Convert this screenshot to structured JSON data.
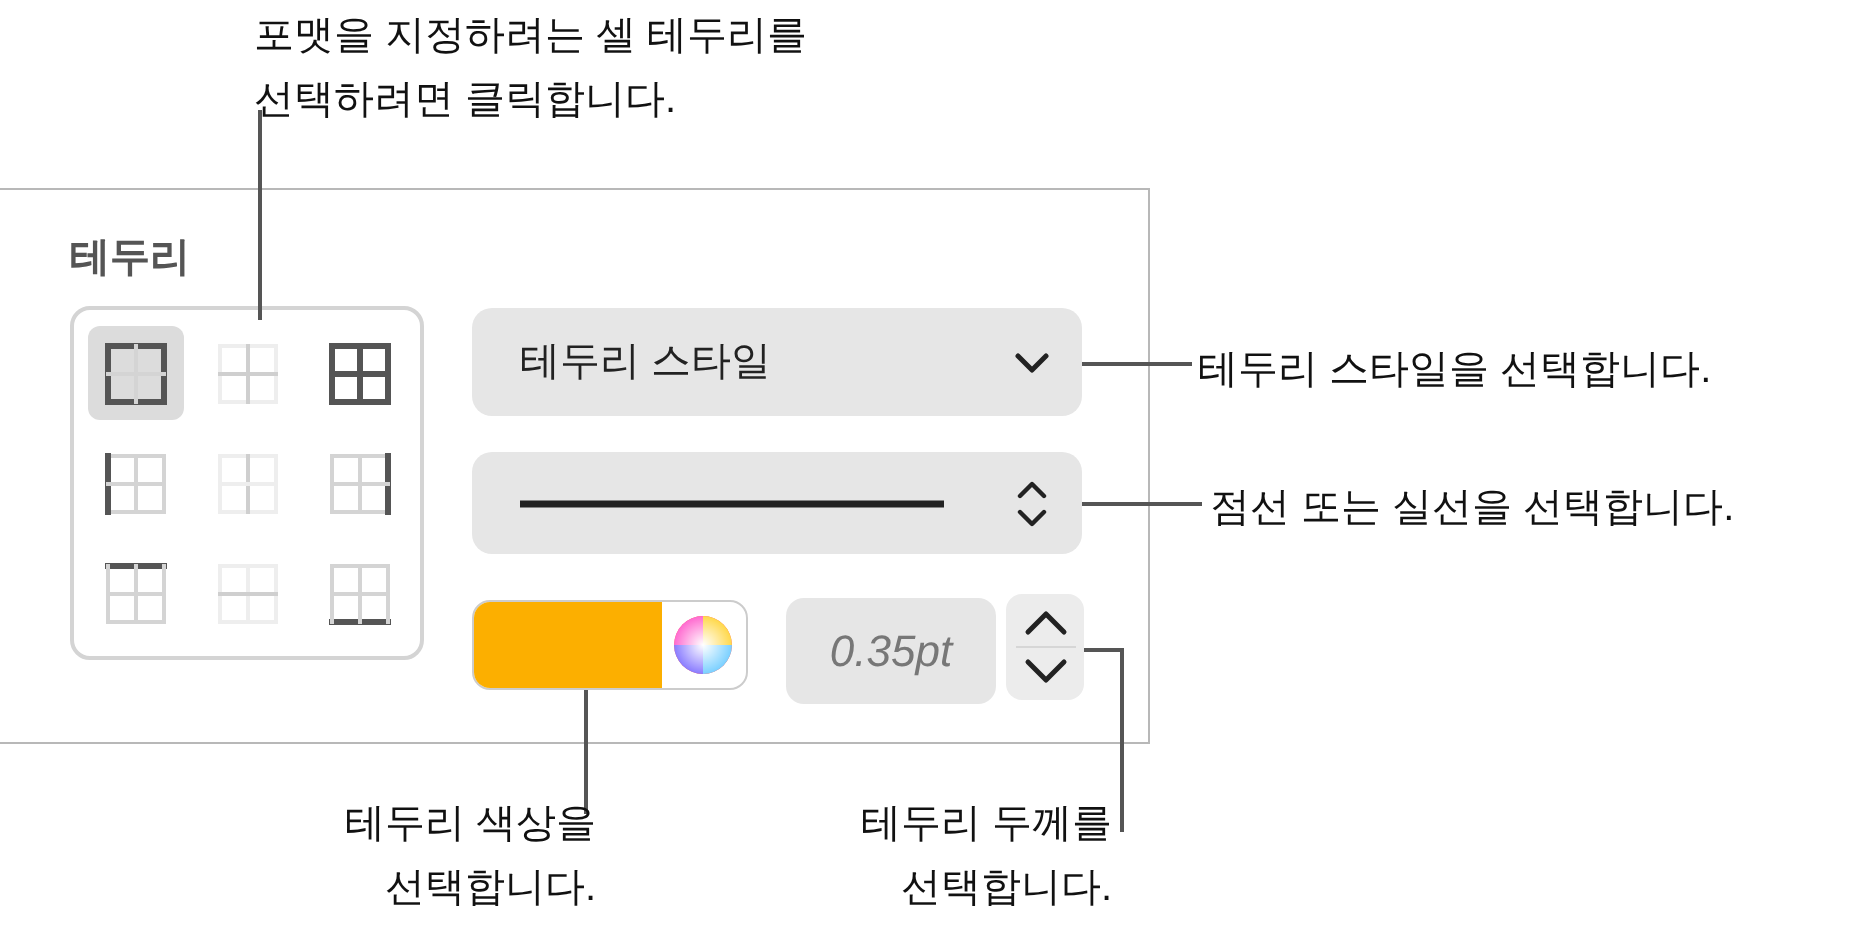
{
  "panel": {
    "title": "테두리",
    "border_cells": [
      {
        "kind": "outer",
        "selected": true
      },
      {
        "kind": "inner",
        "selected": false
      },
      {
        "kind": "all",
        "selected": false
      },
      {
        "kind": "left",
        "selected": false
      },
      {
        "kind": "inner-vertical",
        "selected": false
      },
      {
        "kind": "right",
        "selected": false
      },
      {
        "kind": "top",
        "selected": false
      },
      {
        "kind": "inner-horizontal",
        "selected": false
      },
      {
        "kind": "bottom",
        "selected": false
      }
    ],
    "border_style": {
      "value": "테두리 스타일"
    },
    "line_style": {
      "kind": "solid"
    },
    "color": {
      "color": "#fcaf00"
    },
    "thickness": {
      "value": "0.35pt"
    }
  },
  "callouts": [
    {
      "kind": "top",
      "text": "포맷을 지정하려는 셀 테두리를\n선택하려면 클릭합니다."
    },
    {
      "kind": "style",
      "text": "테두리 스타일을 선택합니다."
    },
    {
      "kind": "line",
      "text": "점선 또는 실선을 선택합니다."
    },
    {
      "kind": "color",
      "text": "테두리 색상을\n선택합니다."
    },
    {
      "kind": "thickness",
      "text": "테두리 두께를\n선택합니다."
    }
  ]
}
